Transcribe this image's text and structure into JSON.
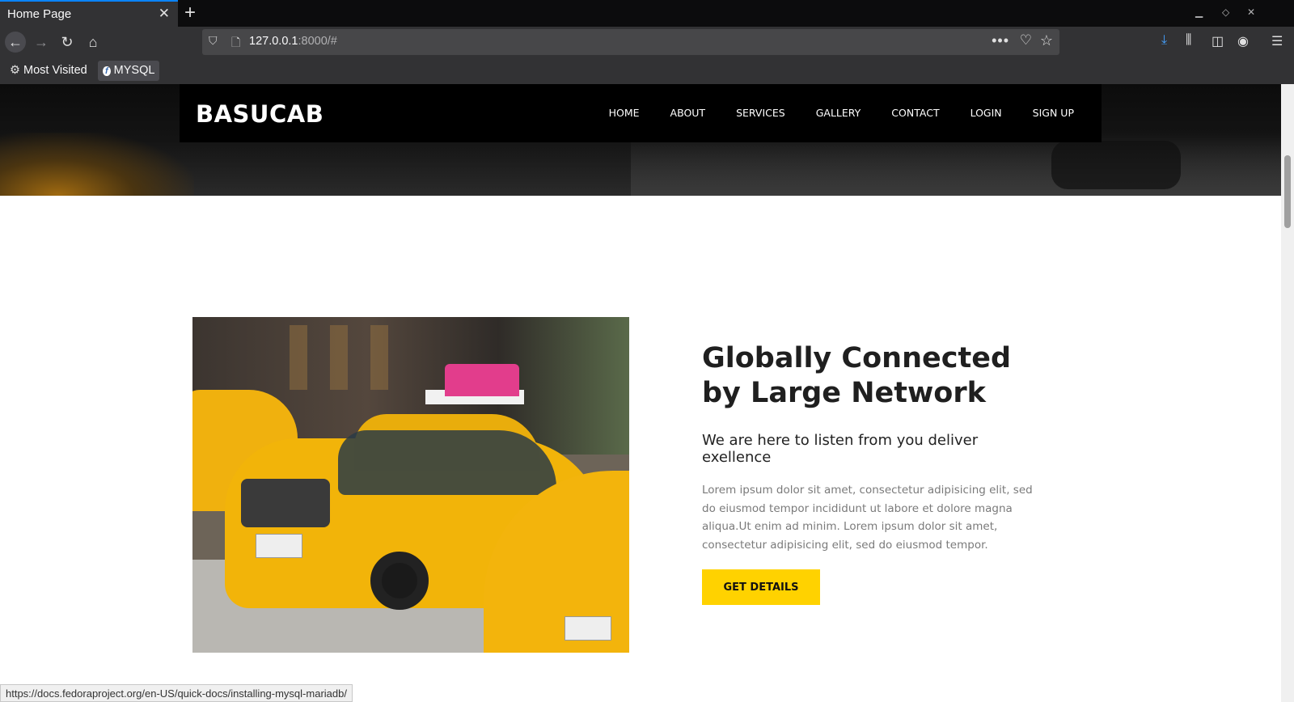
{
  "browser": {
    "tab_title": "Home Page",
    "tab_close": "✕",
    "new_tab": "+",
    "url_host": "127.0.0.1",
    "url_rest": ":8000/#",
    "bookmarks": [
      {
        "label": "Most Visited",
        "icon": "gear-icon"
      },
      {
        "label": "MYSQL",
        "icon": "fedora-icon"
      }
    ],
    "status_url": "https://docs.fedoraproject.org/en-US/quick-docs/installing-mysql-mariadb/"
  },
  "site": {
    "brand": "BASUCAB",
    "nav": [
      "HOME",
      "ABOUT",
      "SERVICES",
      "GALLERY",
      "CONTACT",
      "LOGIN",
      "SIGN UP"
    ]
  },
  "content": {
    "headline": "Globally Connected by Large Network",
    "subhead": "We are here to listen from you deliver exellence",
    "paragraph": "Lorem ipsum dolor sit amet, consectetur adipisicing elit, sed do eiusmod tempor incididunt ut labore et dolore magna aliqua.Ut enim ad minim. Lorem ipsum dolor sit amet, consectetur adipisicing elit, sed do eiusmod tempor.",
    "cta": "GET DETAILS"
  },
  "colors": {
    "accent": "#ffd200",
    "header_bg": "#000000",
    "browser_accent": "#0a84ff"
  }
}
